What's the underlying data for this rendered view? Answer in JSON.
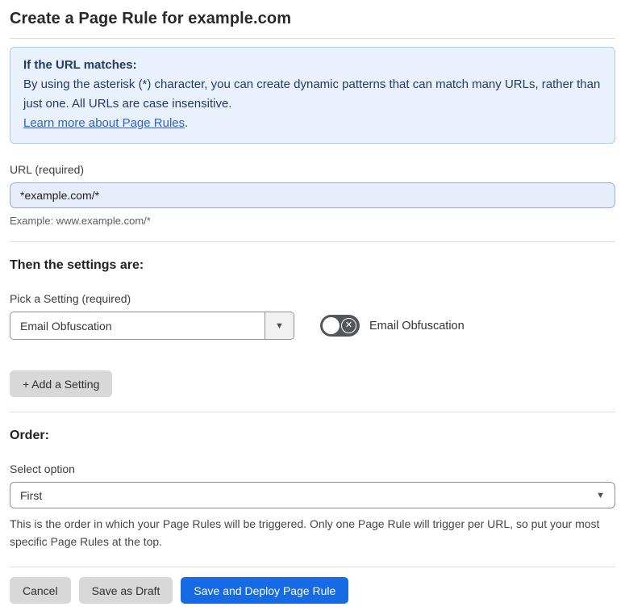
{
  "page": {
    "title": "Create a Page Rule for example.com"
  },
  "info_box": {
    "heading": "If the URL matches:",
    "body": "By using the asterisk (*) character, you can create dynamic patterns that can match many URLs, rather than just one. All URLs are case insensitive.",
    "link": "Learn more about Page Rules",
    "link_suffix": "."
  },
  "url_field": {
    "label": "URL (required)",
    "value": "*example.com/*",
    "example": "Example: www.example.com/*"
  },
  "settings_section": {
    "heading": "Then the settings are:",
    "picker_label": "Pick a Setting (required)",
    "selected_setting": "Email Obfuscation",
    "toggle": {
      "state": "off",
      "label": "Email Obfuscation"
    },
    "add_button_label": "+ Add a Setting"
  },
  "order_section": {
    "heading": "Order:",
    "label": "Select option",
    "selected_option": "First",
    "help": "This is the order in which your Page Rules will be triggered. Only one Page Rule will trigger per URL, so put your most specific Page Rules at the top."
  },
  "footer": {
    "cancel_label": "Cancel",
    "save_draft_label": "Save as Draft",
    "save_deploy_label": "Save and Deploy Page Rule"
  },
  "icons": {
    "caret_down": "▼",
    "toggle_off_x": "✕"
  },
  "colors": {
    "primary_blue": "#166be5",
    "info_bg": "#e9f2fc",
    "info_border": "#a9cdee",
    "info_text": "#223b69",
    "link_blue": "#2c62c9",
    "input_bg": "#e6edfb",
    "toggle_off_bg": "#54565a",
    "button_gray": "#d8d8d8"
  }
}
